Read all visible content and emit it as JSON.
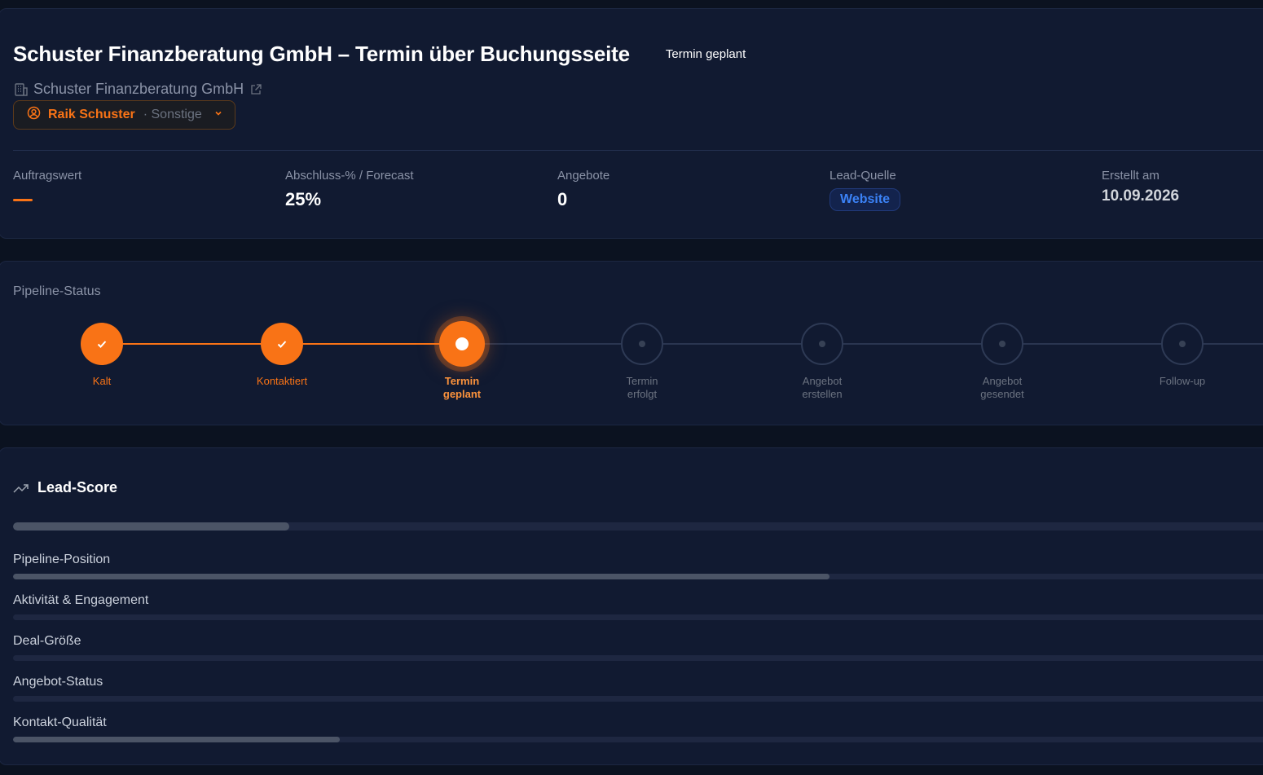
{
  "header": {
    "title": "Schuster Finanzberatung GmbH – Termin über Buchungsseite",
    "status": "Termin geplant",
    "company": "Schuster Finanzberatung GmbH",
    "contact_name": "Raik Schuster",
    "contact_role": "· Sonstige",
    "icons": [
      "building-icon",
      "external-link-icon",
      "user-circle-icon",
      "chevron-down-icon"
    ]
  },
  "stats": [
    {
      "label": "Auftragswert",
      "value": "—"
    },
    {
      "label": "Abschluss-% / Forecast",
      "value": "25%"
    },
    {
      "label": "Angebote",
      "value": "0"
    },
    {
      "label": "Lead-Quelle",
      "value": "Website"
    },
    {
      "label": "Erstellt am",
      "value": "10.09.2026"
    }
  ],
  "pipeline": {
    "label": "Pipeline-Status",
    "current_index": 2,
    "steps": [
      {
        "line1": "Kalt",
        "line2": "",
        "state": "done"
      },
      {
        "line1": "Kontaktiert",
        "line2": "",
        "state": "done"
      },
      {
        "line1": "Termin",
        "line2": "geplant",
        "state": "current"
      },
      {
        "line1": "Termin",
        "line2": "erfolgt",
        "state": "todo"
      },
      {
        "line1": "Angebot",
        "line2": "erstellen",
        "state": "todo"
      },
      {
        "line1": "Angebot",
        "line2": "gesendet",
        "state": "todo"
      },
      {
        "line1": "Follow-up",
        "line2": "",
        "state": "todo"
      }
    ]
  },
  "lead_score": {
    "title": "Lead-Score",
    "total_fraction": 0.22,
    "factors": [
      {
        "label": "Pipeline-Position",
        "fraction": 0.65
      },
      {
        "label": "Aktivität & Engagement",
        "fraction": 0
      },
      {
        "label": "Deal-Größe",
        "fraction": 0
      },
      {
        "label": "Angebot-Status",
        "fraction": 0
      },
      {
        "label": "Kontakt-Qualität",
        "fraction": 0.26
      }
    ]
  },
  "colors": {
    "accent": "#f97316",
    "background": "#0b1220",
    "card": "#111a31",
    "link_blue": "#3b82f6"
  }
}
